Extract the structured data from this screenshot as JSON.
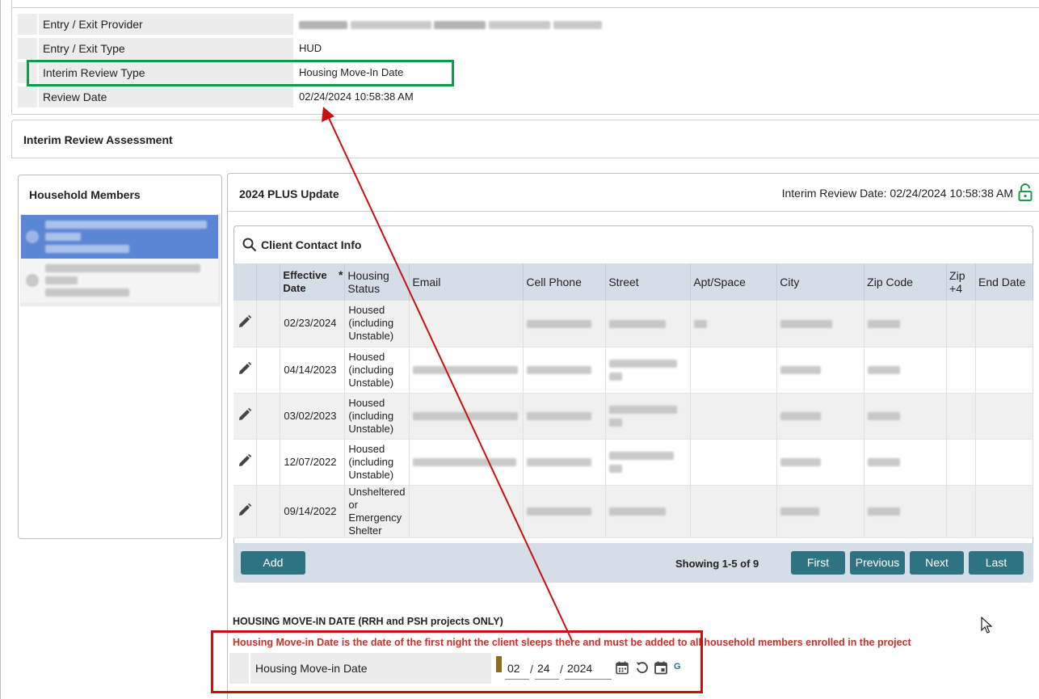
{
  "info": {
    "rows": [
      {
        "label": "Entry / Exit Provider",
        "value": ""
      },
      {
        "label": "Entry / Exit Type",
        "value": "HUD"
      },
      {
        "label": "Interim Review Type",
        "value": "Housing Move-In Date"
      },
      {
        "label": "Review Date",
        "value": "02/24/2024 10:58:38 AM"
      }
    ]
  },
  "assessment": {
    "title": "Interim Review Assessment"
  },
  "household": {
    "title": "Household Members"
  },
  "plus": {
    "title": "2024 PLUS Update",
    "review_date_text": "Interim Review Date: 02/24/2024 10:58:38 AM"
  },
  "contact": {
    "title": "Client Contact Info",
    "columns": {
      "effective_date": "Effective Date",
      "required_mark": "*",
      "housing_status": "Housing Status",
      "email": "Email",
      "cell_phone": "Cell Phone",
      "street": "Street",
      "apt_space": "Apt/Space",
      "city": "City",
      "zip_code": "Zip Code",
      "zip4": "Zip +4",
      "end_date": "End Date"
    },
    "rows": [
      {
        "effective_date": "02/23/2024",
        "housing_status": "Housed (including Unstable)"
      },
      {
        "effective_date": "04/14/2023",
        "housing_status": "Housed (including Unstable)"
      },
      {
        "effective_date": "03/02/2023",
        "housing_status": "Housed (including Unstable)"
      },
      {
        "effective_date": "12/07/2022",
        "housing_status": "Housed (including Unstable)"
      },
      {
        "effective_date": "09/14/2022",
        "housing_status": "Unsheltered or Emergency Shelter"
      }
    ],
    "add_label": "Add",
    "showing": "Showing 1-5 of 9",
    "first_label": "First",
    "previous_label": "Previous",
    "next_label": "Next",
    "last_label": "Last"
  },
  "move_in": {
    "section_title": "HOUSING MOVE-IN DATE (RRH and PSH projects ONLY)",
    "note": "Housing Move-in Date is the date of the first night the client sleeps there and must be added to all household members enrolled in the project",
    "label": "Housing Move-in Date",
    "month": "02",
    "day": "24",
    "year": "2024",
    "g_label": "G"
  },
  "colors": {
    "accent": "#2e7381",
    "header_bg": "#d5dde6",
    "selected_member": "#5b86d6",
    "annotation_green": "#129a4c",
    "annotation_red": "#c90f12",
    "note_red": "#c9302c"
  }
}
